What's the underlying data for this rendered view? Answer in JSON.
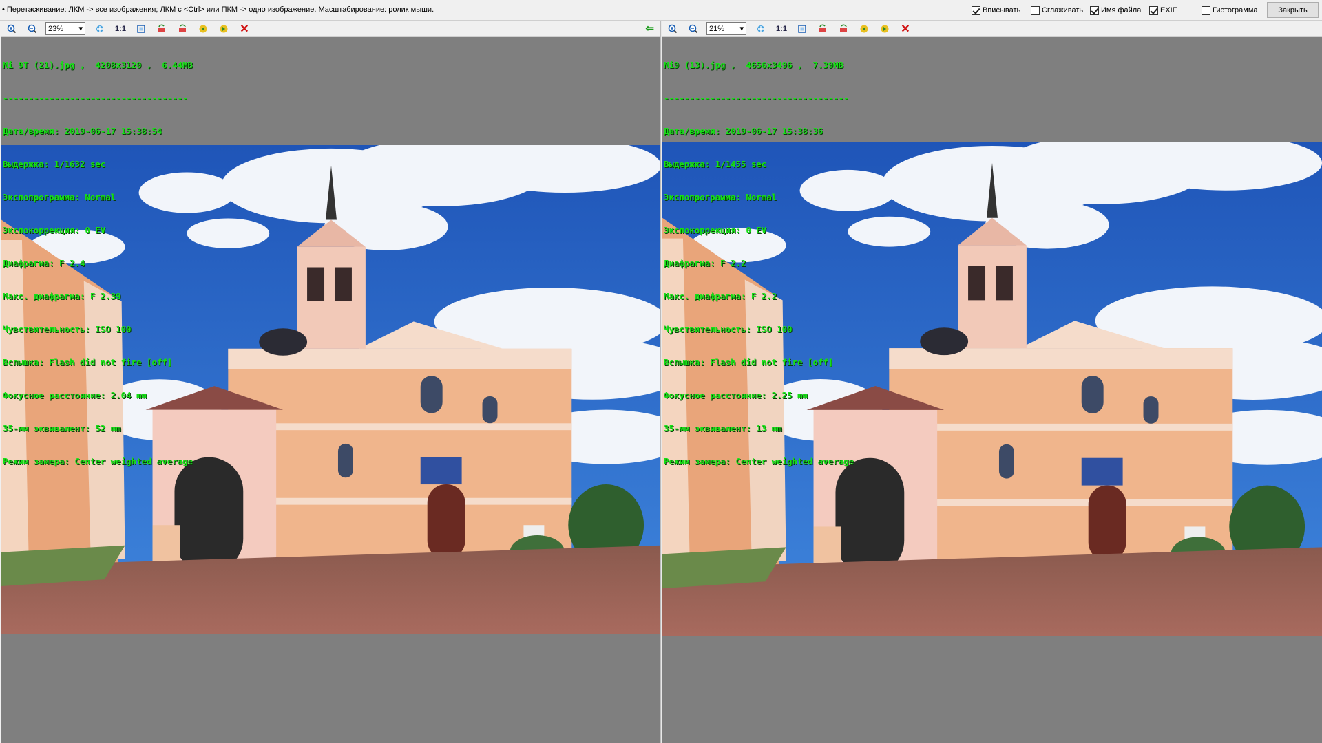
{
  "topbar": {
    "hint": "• Перетаскивание: ЛКМ -> все изображения; ЛКМ с <Ctrl> или ПКМ -> одно изображение. Масштабирование: ролик мыши.",
    "options": [
      {
        "label": "Вписывать",
        "checked": true
      },
      {
        "label": "Сглаживать",
        "checked": false
      },
      {
        "label": "Имя файла",
        "checked": true
      },
      {
        "label": "EXIF",
        "checked": true
      },
      {
        "label": "Гистограмма",
        "checked": false
      }
    ],
    "close_label": "Закрыть"
  },
  "panes": [
    {
      "zoom": "23%",
      "one_to_one": "1:1",
      "file_line": "Mi 9T (21).jpg ,  4208x3120 ,  6.44MB",
      "separator": "------------------------------------",
      "exif": [
        "Дата/время: 2019-06-17 15:38:54",
        "Выдержка: 1/1632 sec",
        "Экспопрограмма: Normal",
        "Экспокоррекция: 0 EV",
        "Диафрагма: F 2.4",
        "Макс. диафрагма: F 2.39",
        "Чувствительность: ISO 100",
        "Вспышка: Flash did not fire [off]",
        "Фокусное расстояние: 2.04 mm",
        "35-мм эквивалент: 52 mm",
        "Режим замера: Center weighted average"
      ]
    },
    {
      "zoom": "21%",
      "one_to_one": "1:1",
      "file_line": "Mi9 (13).jpg ,  4656x3496 ,  7.39MB",
      "separator": "------------------------------------",
      "exif": [
        "Дата/время: 2019-06-17 15:38:36",
        "Выдержка: 1/1455 sec",
        "Экспопрограмма: Normal",
        "Экспокоррекция: 0 EV",
        "Диафрагма: F 2.2",
        "Макс. диафрагма: F 2.2",
        "Чувствительность: ISO 100",
        "Вспышка: Flash did not fire [off]",
        "Фокусное расстояние: 2.25 mm",
        "35-мм эквивалент: 13 mm",
        "Режим замера: Center weighted average"
      ]
    }
  ],
  "icons": {
    "zoom_in": "zoom-in-icon",
    "zoom_out": "zoom-out-icon",
    "fit": "fit-icon",
    "actual_size": "actual-size-icon",
    "frame": "frame-icon",
    "rotate_left": "rotate-left-icon",
    "rotate_right": "rotate-right-icon",
    "prev": "prev-image-icon",
    "next": "next-image-icon",
    "close": "close-icon",
    "back": "back-arrow-icon"
  },
  "colors": {
    "exif_text": "#16e016",
    "pane_bg": "#7f7f7f",
    "sky": "#2f6fd0"
  }
}
